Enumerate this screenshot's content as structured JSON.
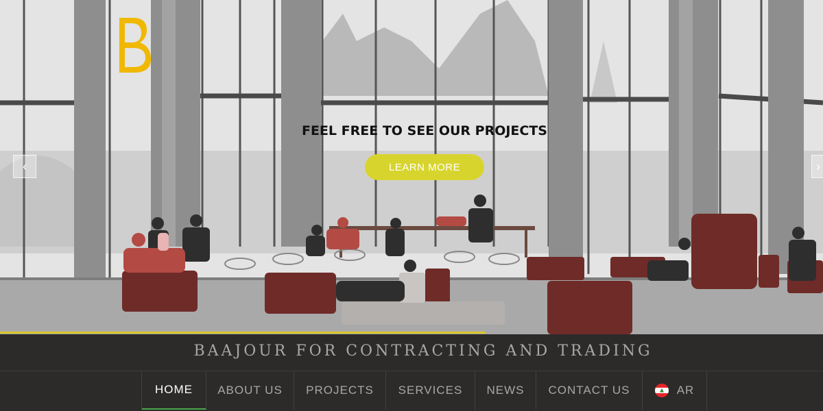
{
  "logo": {
    "letter": "B",
    "color": "#f0b800"
  },
  "hero": {
    "title": "FEEL FREE TO SEE OUR PROJECTS",
    "button_label": "LEARN MORE",
    "prev_glyph": "‹",
    "next_glyph": "›",
    "slide_progress": 0.59,
    "accent": "#d8d42e"
  },
  "brand": {
    "name": "BAAJOUR FOR CONTRACTING AND TRADING"
  },
  "nav": {
    "items": [
      {
        "label": "HOME",
        "active": true
      },
      {
        "label": "ABOUT US"
      },
      {
        "label": "PROJECTS"
      },
      {
        "label": "SERVICES"
      },
      {
        "label": "NEWS"
      },
      {
        "label": "CONTACT US"
      },
      {
        "label": "AR",
        "icon": "lebanon-flag-icon"
      }
    ]
  }
}
